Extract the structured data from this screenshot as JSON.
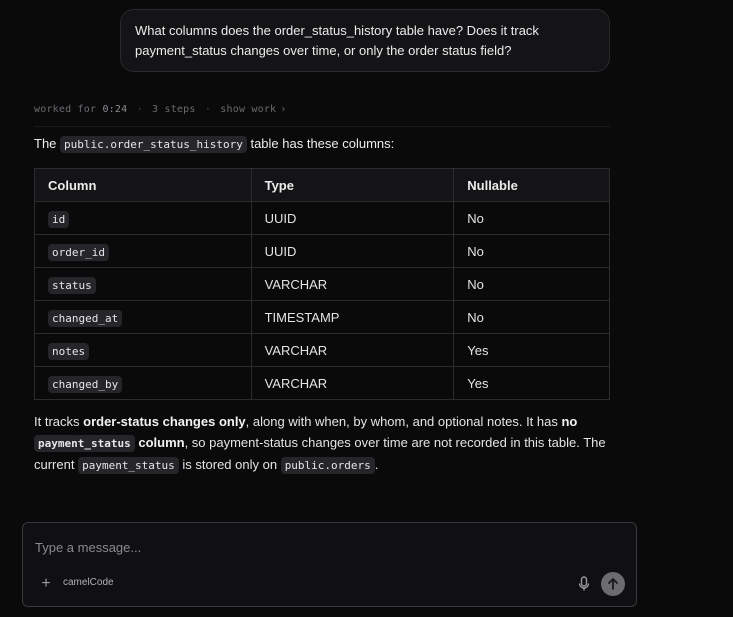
{
  "user_message": "What columns does the order_status_history table have? Does it track payment_status changes over time, or only the order status field?",
  "worked": {
    "prefix": "worked for",
    "time": "0:24",
    "steps": "3 steps",
    "show_work": "show work",
    "chevron": "›"
  },
  "answer": {
    "intro_before": "The",
    "intro_code": "public.order_status_history",
    "intro_after": "table has these columns:",
    "table": {
      "headers": [
        "Column",
        "Type",
        "Nullable"
      ],
      "rows": [
        [
          "id",
          "UUID",
          "No"
        ],
        [
          "order_id",
          "UUID",
          "No"
        ],
        [
          "status",
          "VARCHAR",
          "No"
        ],
        [
          "changed_at",
          "TIMESTAMP",
          "No"
        ],
        [
          "notes",
          "VARCHAR",
          "Yes"
        ],
        [
          "changed_by",
          "VARCHAR",
          "Yes"
        ]
      ]
    },
    "summary": {
      "t1": "It tracks ",
      "b1": "order-status changes only",
      "t2": ", along with when, by whom, and optional notes. It has ",
      "b2": "no",
      "c1": "payment_status",
      "b3": "column",
      "t3": ", so payment-status changes over time are not recorded in this table. The current ",
      "c2": "payment_status",
      "t4": " is stored only on ",
      "c3": "public.orders",
      "t5": "."
    }
  },
  "composer": {
    "placeholder": "Type a message...",
    "plus": "+",
    "model": "camelCode"
  }
}
